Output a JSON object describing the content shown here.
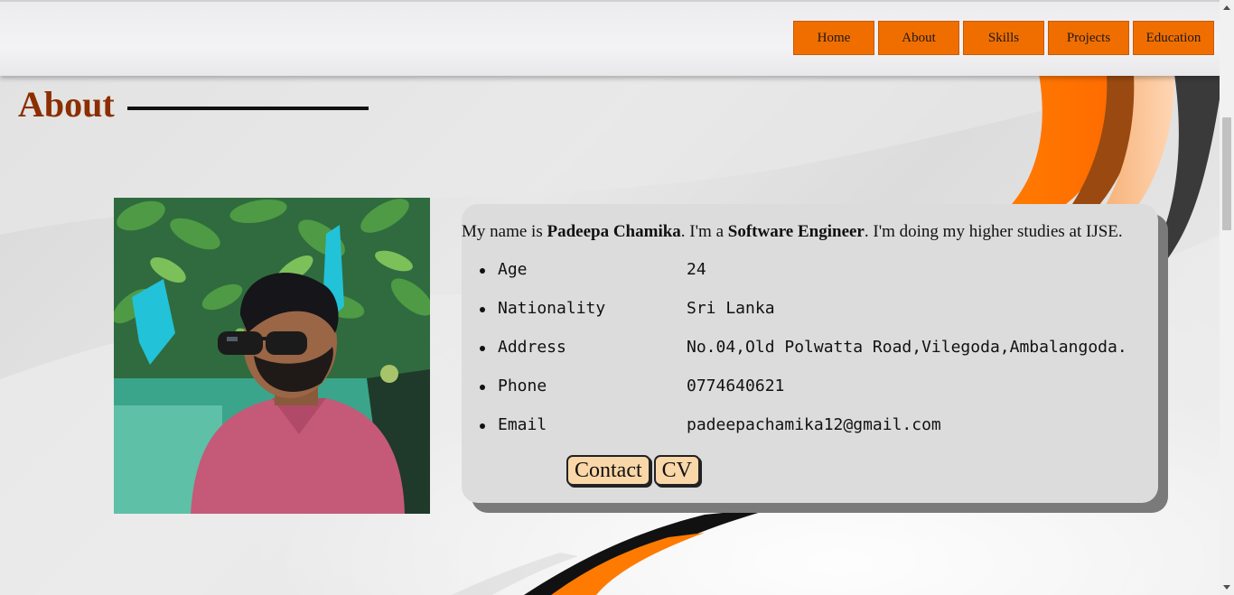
{
  "nav": {
    "items": [
      {
        "label": "Home"
      },
      {
        "label": "About"
      },
      {
        "label": "Skills"
      },
      {
        "label": "Projects"
      },
      {
        "label": "Education"
      }
    ]
  },
  "about": {
    "title": "About",
    "intro": {
      "prefix": "My name is ",
      "name": "Padeepa Chamika",
      "middle": ". I'm a ",
      "role": "Software Engineer",
      "suffix": ". I'm doing my higher studies at IJSE."
    },
    "details": [
      {
        "key": "Age",
        "value": "24"
      },
      {
        "key": "Nationality",
        "value": "Sri Lanka"
      },
      {
        "key": "Address",
        "value": "No.04,Old Polwatta Road,Vilegoda,Ambalangoda."
      },
      {
        "key": "Phone",
        "value": "0774640621"
      },
      {
        "key": "Email",
        "value": "padeepachamika12@gmail.com"
      }
    ],
    "buttons": {
      "contact": "Contact",
      "cv": "CV"
    }
  },
  "colors": {
    "accent": "#f06e00",
    "title": "#8b2e00",
    "button_fill": "#fad7a8",
    "card": "#dcdcdc"
  },
  "icons": {
    "scroll_up": "chevron-up-icon",
    "scroll_down": "chevron-down-icon"
  }
}
